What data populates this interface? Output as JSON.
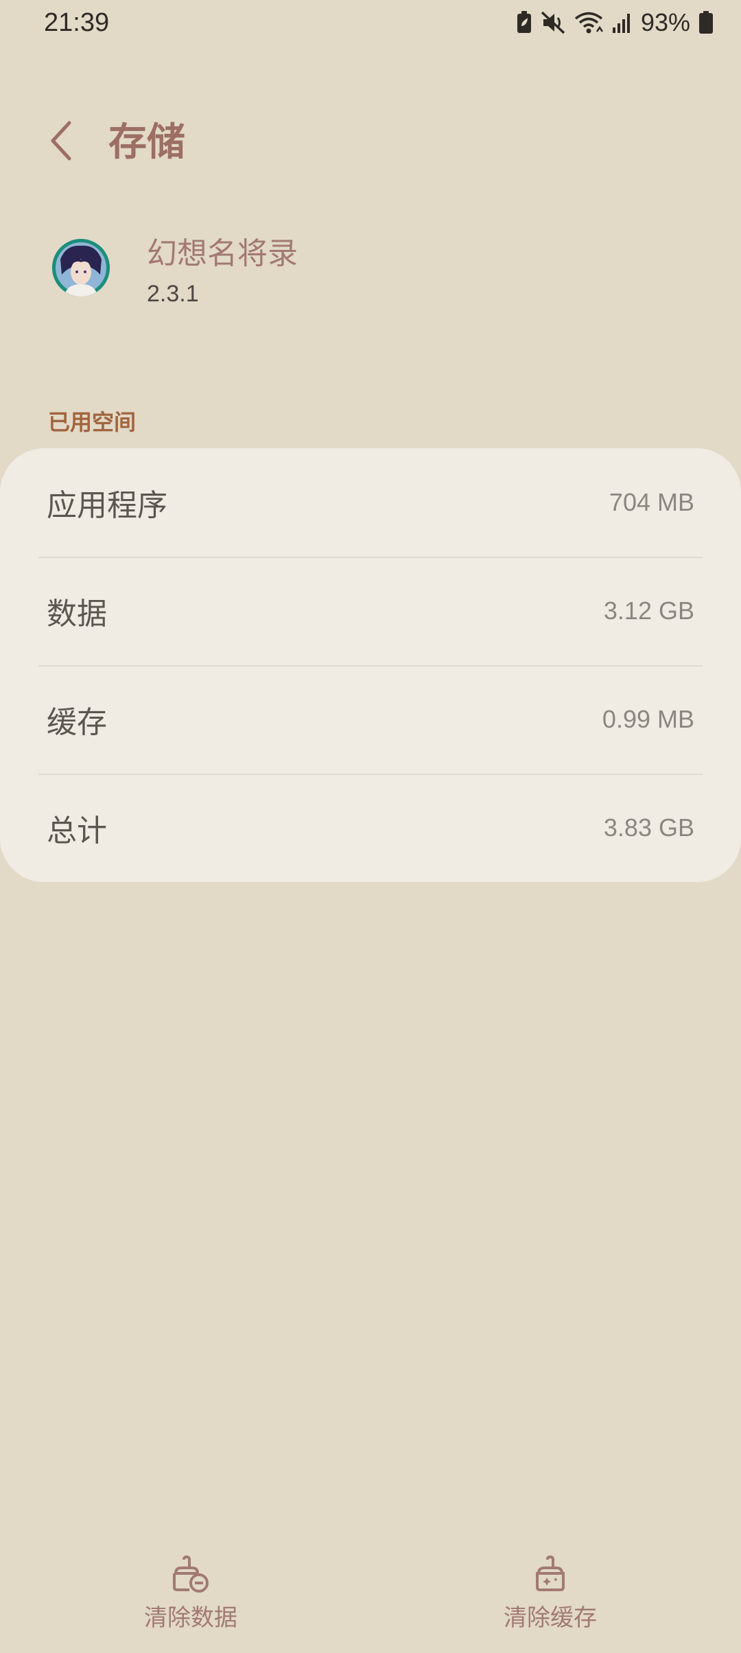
{
  "status_bar": {
    "time": "21:39",
    "battery_percent": "93%",
    "icons": [
      "battery-saver-icon",
      "mute-icon",
      "wifi-icon",
      "signal-icon",
      "battery-icon"
    ]
  },
  "header": {
    "title": "存储",
    "back_icon": "chevron-left-icon"
  },
  "app": {
    "name": "幻想名将录",
    "version": "2.3.1"
  },
  "storage": {
    "section_title": "已用空间",
    "rows": [
      {
        "label": "应用程序",
        "value": "704 MB"
      },
      {
        "label": "数据",
        "value": "3.12 GB"
      },
      {
        "label": "缓存",
        "value": "0.99 MB"
      },
      {
        "label": "总计",
        "value": "3.83 GB"
      }
    ]
  },
  "actions": {
    "clear_data": "清除数据",
    "clear_cache": "清除缓存"
  },
  "colors": {
    "background": "#E2D9C7",
    "card": "#F0EBE3",
    "accent": "#9C6E64",
    "section_accent": "#A0653E"
  }
}
